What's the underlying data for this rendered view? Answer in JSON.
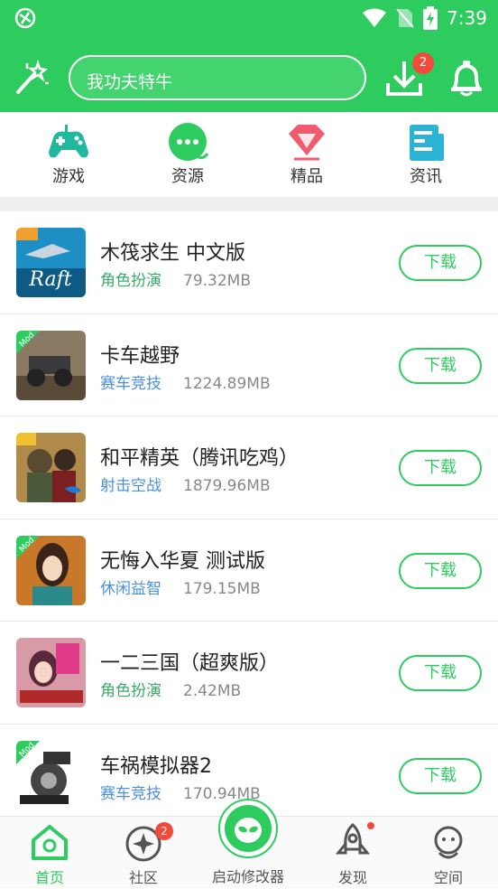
{
  "status_bar": {
    "time": "7:39"
  },
  "header": {
    "search_text": "我功夫特牛",
    "download_badge": "2"
  },
  "categories": [
    {
      "label": "游戏",
      "icon": "gamepad-icon"
    },
    {
      "label": "资源",
      "icon": "chat-bubble-icon"
    },
    {
      "label": "精品",
      "icon": "diamond-icon"
    },
    {
      "label": "资讯",
      "icon": "news-icon"
    }
  ],
  "apps": [
    {
      "title": "木筏求生  中文版",
      "category": "角色扮演",
      "size": "79.32MB",
      "button": "下载"
    },
    {
      "title": "卡车越野",
      "category": "赛车竞技",
      "size": "1224.89MB",
      "button": "下载"
    },
    {
      "title": "和平精英（腾讯吃鸡）",
      "category": "射击空战",
      "size": "1879.96MB",
      "button": "下载"
    },
    {
      "title": "无悔入华夏  测试版",
      "category": "休闲益智",
      "size": "179.15MB",
      "button": "下载"
    },
    {
      "title": "一二三国（超爽版）",
      "category": "角色扮演",
      "size": "2.42MB",
      "button": "下载"
    },
    {
      "title": "车祸模拟器2",
      "category": "赛车竞技",
      "size": "170.94MB",
      "button": "下载"
    }
  ],
  "tabbar": {
    "home": "首页",
    "community": "社区",
    "community_badge": "2",
    "launcher": "启动修改器",
    "discover": "发现",
    "space": "空间"
  },
  "colors": {
    "primary": "#2ecc5f",
    "badge": "#f24b3c",
    "category_green": "#3aaa6a",
    "category_blue": "#4a90e2"
  }
}
